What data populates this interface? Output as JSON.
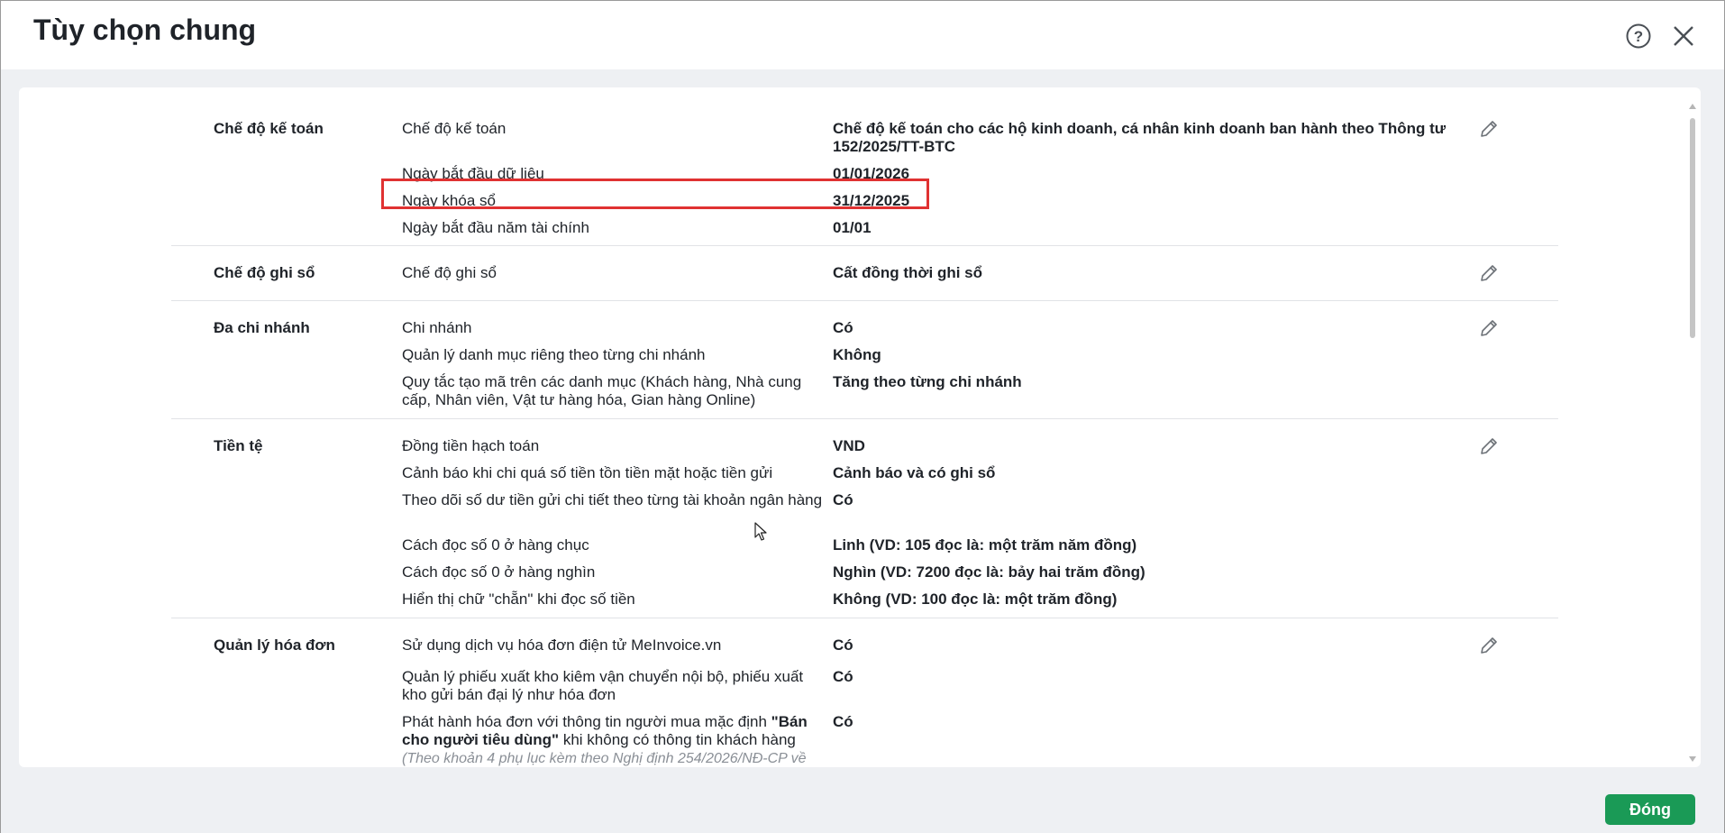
{
  "header": {
    "title": "Tùy chọn chung"
  },
  "sections": [
    {
      "title": "Chế độ kế toán",
      "rows": [
        {
          "label": "Chế độ kế toán",
          "value": "Chế độ kế toán cho các hộ kinh doanh, cá nhân kinh doanh ban hành theo Thông tư 152/2025/TT-BTC"
        },
        {
          "label": "Ngày bắt đầu dữ liệu",
          "value": "01/01/2026"
        },
        {
          "label": "Ngày khóa sổ",
          "value": "31/12/2025"
        },
        {
          "label": "Ngày bắt đầu năm tài chính",
          "value": "01/01"
        }
      ]
    },
    {
      "title": "Chế độ ghi sổ",
      "rows": [
        {
          "label": "Chế độ ghi sổ",
          "value": "Cất đồng thời ghi sổ"
        }
      ]
    },
    {
      "title": "Đa chi nhánh",
      "rows": [
        {
          "label": "Chi nhánh",
          "value": "Có"
        },
        {
          "label": "Quản lý danh mục riêng theo từng chi nhánh",
          "value": "Không"
        },
        {
          "label": "Quy tắc tạo mã trên các danh mục (Khách hàng, Nhà cung cấp, Nhân viên, Vật tư hàng hóa, Gian hàng Online)",
          "value": "Tăng theo từng chi nhánh"
        }
      ]
    },
    {
      "title": "Tiền tệ",
      "rows": [
        {
          "label": "Đồng tiền hạch toán",
          "value": "VND"
        },
        {
          "label": "Cảnh báo khi chi quá số tiền tồn tiền mặt hoặc tiền gửi",
          "value": "Cảnh báo và có ghi sổ"
        },
        {
          "label": "Theo dõi số dư tiền gửi chi tiết theo từng tài khoản ngân hàng",
          "value": "Có"
        },
        {
          "label": "Cách đọc số 0 ở hàng chục",
          "value": "Linh (VD: 105 đọc là: một trăm năm đồng)"
        },
        {
          "label": "Cách đọc số 0 ở hàng nghìn",
          "value": "Nghìn (VD: 7200 đọc là: bảy hai trăm đồng)"
        },
        {
          "label": "Hiển thị chữ \"chẵn\" khi đọc số tiền",
          "value": "Không (VD: 100 đọc là: một trăm đồng)"
        }
      ]
    },
    {
      "title": "Quản lý hóa đơn",
      "rows": [
        {
          "label": "Sử dụng dịch vụ hóa đơn điện tử MeInvoice.vn",
          "value": "Có"
        },
        {
          "label": "Quản lý phiếu xuất kho kiêm vận chuyển nội bộ, phiếu xuất kho gửi bán đại lý như hóa đơn",
          "value": "Có"
        },
        {
          "label_pre": "Phát hành hóa đơn với thông tin người mua mặc định ",
          "label_bold": "\"Bán cho người tiêu dùng\"",
          "label_post": " khi không có thông tin khách hàng",
          "label_note": "(Theo khoản 4 phụ lục kèm theo Nghị định 254/2026/NĐ-CP về",
          "value": "Có"
        }
      ]
    }
  ],
  "footer": {
    "close_label": "Đóng"
  },
  "colors": {
    "primary_button": "#1a9a56",
    "highlight": "#e03232",
    "background": "#eef0f3"
  }
}
